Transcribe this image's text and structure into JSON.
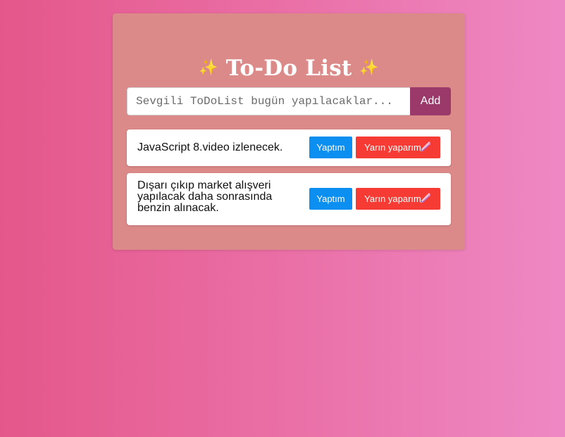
{
  "app": {
    "title": "To-Do List",
    "sparkle_glyph": "✨"
  },
  "input": {
    "placeholder": "Sevgili ToDoList bugün yapılacaklar...",
    "value": "",
    "add_label": "Add"
  },
  "tasks": [
    {
      "text": "JavaScript 8.video izlenecek.",
      "done_label": "Yaptım",
      "later_label": "Yarın yaparım"
    },
    {
      "text": "Dışarı çıkıp market alışveri yapılacak daha sonrasında benzin alınacak.",
      "done_label": "Yaptım",
      "later_label": "Yarın yaparım"
    }
  ],
  "icons": {
    "title_decoration": "sparkles-icon",
    "later_button": "writing-hand-icon"
  },
  "colors": {
    "background_start": "#e4578a",
    "background_end": "#ee88c4",
    "card": "#dc8a89",
    "add_button": "#9b3a6a",
    "done_button": "#0b8ff0",
    "later_button": "#f63b35"
  }
}
